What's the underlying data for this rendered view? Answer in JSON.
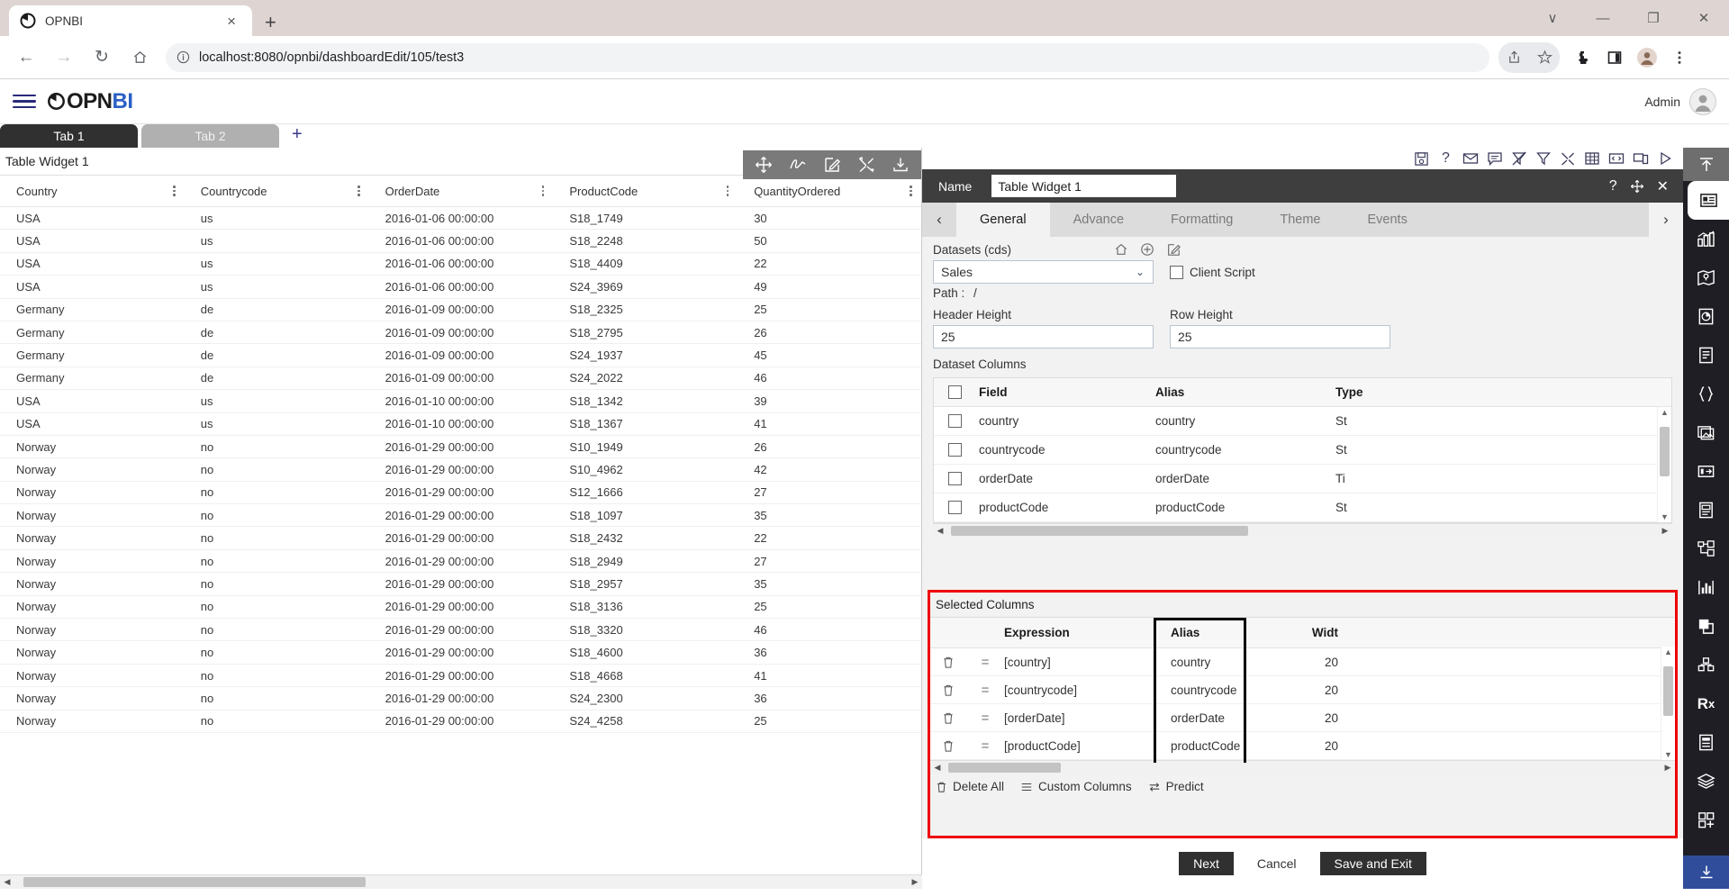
{
  "browser": {
    "tab_title": "OPNBI",
    "tab_close": "×",
    "new_tab": "+",
    "url_full": "localhost:8080/opnbi/dashboardEdit/105/test3",
    "url_host": "localhost:8080",
    "url_path": "/opnbi/dashboardEdit/105/test3",
    "window_controls": [
      "∨",
      "—",
      "❐",
      "✕"
    ]
  },
  "app": {
    "brand_op": "OPN",
    "brand_bi": "BI",
    "user": "Admin"
  },
  "dashboard_tabs": [
    {
      "label": "Tab 1",
      "active": true
    },
    {
      "label": "Tab 2",
      "active": false
    }
  ],
  "dashboard_tab_add": "+",
  "widget": {
    "title": "Table Widget 1",
    "toolbar_icons": [
      "move-icon",
      "pen-icon",
      "edit-icon",
      "tools-icon",
      "download-icon"
    ]
  },
  "data_table": {
    "columns": [
      "Country",
      "Countrycode",
      "OrderDate",
      "ProductCode",
      "QuantityOrdered"
    ],
    "rows": [
      [
        "USA",
        "us",
        "2016-01-06 00:00:00",
        "S18_1749",
        "30"
      ],
      [
        "USA",
        "us",
        "2016-01-06 00:00:00",
        "S18_2248",
        "50"
      ],
      [
        "USA",
        "us",
        "2016-01-06 00:00:00",
        "S18_4409",
        "22"
      ],
      [
        "USA",
        "us",
        "2016-01-06 00:00:00",
        "S24_3969",
        "49"
      ],
      [
        "Germany",
        "de",
        "2016-01-09 00:00:00",
        "S18_2325",
        "25"
      ],
      [
        "Germany",
        "de",
        "2016-01-09 00:00:00",
        "S18_2795",
        "26"
      ],
      [
        "Germany",
        "de",
        "2016-01-09 00:00:00",
        "S24_1937",
        "45"
      ],
      [
        "Germany",
        "de",
        "2016-01-09 00:00:00",
        "S24_2022",
        "46"
      ],
      [
        "USA",
        "us",
        "2016-01-10 00:00:00",
        "S18_1342",
        "39"
      ],
      [
        "USA",
        "us",
        "2016-01-10 00:00:00",
        "S18_1367",
        "41"
      ],
      [
        "Norway",
        "no",
        "2016-01-29 00:00:00",
        "S10_1949",
        "26"
      ],
      [
        "Norway",
        "no",
        "2016-01-29 00:00:00",
        "S10_4962",
        "42"
      ],
      [
        "Norway",
        "no",
        "2016-01-29 00:00:00",
        "S12_1666",
        "27"
      ],
      [
        "Norway",
        "no",
        "2016-01-29 00:00:00",
        "S18_1097",
        "35"
      ],
      [
        "Norway",
        "no",
        "2016-01-29 00:00:00",
        "S18_2432",
        "22"
      ],
      [
        "Norway",
        "no",
        "2016-01-29 00:00:00",
        "S18_2949",
        "27"
      ],
      [
        "Norway",
        "no",
        "2016-01-29 00:00:00",
        "S18_2957",
        "35"
      ],
      [
        "Norway",
        "no",
        "2016-01-29 00:00:00",
        "S18_3136",
        "25"
      ],
      [
        "Norway",
        "no",
        "2016-01-29 00:00:00",
        "S18_3320",
        "46"
      ],
      [
        "Norway",
        "no",
        "2016-01-29 00:00:00",
        "S18_4600",
        "36"
      ],
      [
        "Norway",
        "no",
        "2016-01-29 00:00:00",
        "S18_4668",
        "41"
      ],
      [
        "Norway",
        "no",
        "2016-01-29 00:00:00",
        "S24_2300",
        "36"
      ],
      [
        "Norway",
        "no",
        "2016-01-29 00:00:00",
        "S24_4258",
        "25"
      ]
    ]
  },
  "toolstrip_icons": [
    "save-icon",
    "help-icon",
    "mail-icon",
    "comment-icon",
    "filter-off-icon",
    "filter-icon",
    "tools-icon",
    "table-icon",
    "code-icon",
    "devices-icon",
    "play-icon"
  ],
  "panel": {
    "name_label": "Name",
    "name_value": "Table Widget 1",
    "header_controls": [
      "help-icon",
      "move-icon",
      "close-icon"
    ],
    "tabs": [
      {
        "label": "General",
        "active": true
      },
      {
        "label": "Advance",
        "active": false
      },
      {
        "label": "Formatting",
        "active": false
      },
      {
        "label": "Theme",
        "active": false
      },
      {
        "label": "Events",
        "active": false
      }
    ],
    "prev_arrow": "‹",
    "next_arrow": "›",
    "datasets_label": "Datasets (cds)",
    "datasets_icons": [
      "home-icon",
      "plus-circle-icon",
      "edit-icon"
    ],
    "dataset_value": "Sales",
    "path_label": "Path :",
    "path_value": "/",
    "client_script_label": "Client Script",
    "header_height_label": "Header Height",
    "header_height_value": "25",
    "row_height_label": "Row Height",
    "row_height_value": "25",
    "dataset_columns_label": "Dataset Columns",
    "dataset_columns_headers": [
      "Field",
      "Alias",
      "Type"
    ],
    "dataset_columns_rows": [
      {
        "field": "country",
        "alias": "country",
        "type": "St"
      },
      {
        "field": "countrycode",
        "alias": "countrycode",
        "type": "St"
      },
      {
        "field": "orderDate",
        "alias": "orderDate",
        "type": "Ti"
      },
      {
        "field": "productCode",
        "alias": "productCode",
        "type": "St"
      }
    ],
    "selected_columns_label": "Selected Columns",
    "selected_columns_headers": [
      "Expression",
      "Alias",
      "Widt"
    ],
    "selected_columns_rows": [
      {
        "expression": "[country]",
        "alias": "country",
        "width": "20"
      },
      {
        "expression": "[countrycode]",
        "alias": "countrycode",
        "width": "20"
      },
      {
        "expression": "[orderDate]",
        "alias": "orderDate",
        "width": "20"
      },
      {
        "expression": "[productCode]",
        "alias": "productCode",
        "width": "20"
      }
    ],
    "footer_actions": [
      {
        "label": "Delete All",
        "icon": "trash-icon"
      },
      {
        "label": "Custom Columns",
        "icon": "list-icon"
      },
      {
        "label": "Predict",
        "icon": "swap-icon"
      }
    ],
    "buttons": {
      "next": "Next",
      "cancel": "Cancel",
      "save_exit": "Save and Exit"
    },
    "highlight_color": "#ee0000",
    "alias_highlight_color": "#000000"
  },
  "rail": {
    "top_icon": "collapse-up-icon",
    "items": [
      "widget-icon",
      "chart-icon",
      "map-icon",
      "pie-doc-icon",
      "document-icon",
      "braces-icon",
      "images-icon",
      "card-icon",
      "report-icon",
      "tree-icon",
      "sparkline-icon",
      "copy-icon",
      "cube-icon",
      "rx-icon",
      "form-icon",
      "layers-icon",
      "apps-add-icon"
    ],
    "bottom_icon": "download-icon"
  }
}
